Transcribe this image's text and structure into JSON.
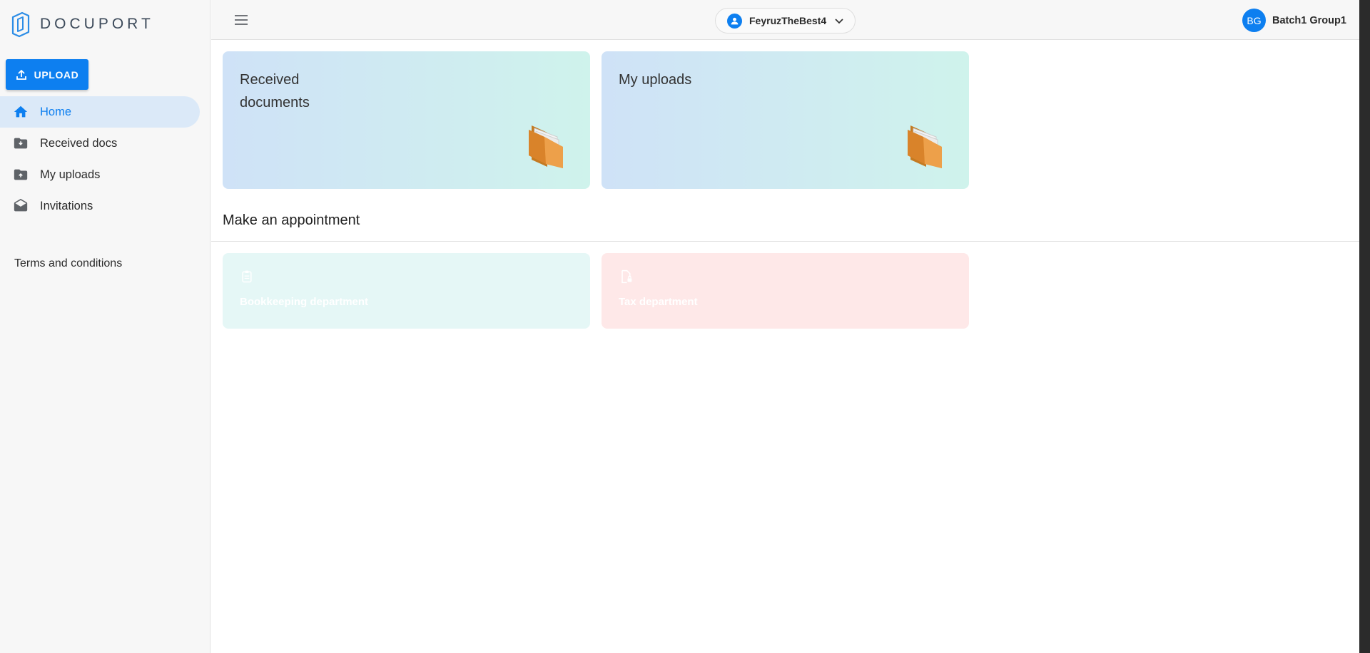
{
  "brand": {
    "name": "DOCUPORT"
  },
  "sidebar": {
    "upload_label": "UPLOAD",
    "items": [
      {
        "label": "Home",
        "icon": "home-icon",
        "active": true
      },
      {
        "label": "Received docs",
        "icon": "folder-download-icon",
        "active": false
      },
      {
        "label": "My uploads",
        "icon": "folder-upload-icon",
        "active": false
      },
      {
        "label": "Invitations",
        "icon": "envelope-open-icon",
        "active": false
      }
    ],
    "terms_label": "Terms and conditions"
  },
  "topbar": {
    "account_name": "FeyruzTheBest4",
    "user_initials": "BG",
    "user_name": "Batch1 Group1"
  },
  "cards": [
    {
      "title": "Received documents",
      "icon": "folder-icon"
    },
    {
      "title": "My uploads",
      "icon": "folder-icon"
    }
  ],
  "appointment": {
    "section_title": "Make an appointment",
    "departments": [
      {
        "label": "Bookkeeping department",
        "icon": "clipboard-icon",
        "color": "#e5f7f6"
      },
      {
        "label": "Tax department",
        "icon": "document-lock-icon",
        "color": "#fee8e8"
      }
    ]
  },
  "colors": {
    "accent": "#0d7ff0",
    "active_bg": "#dbe9f8"
  }
}
